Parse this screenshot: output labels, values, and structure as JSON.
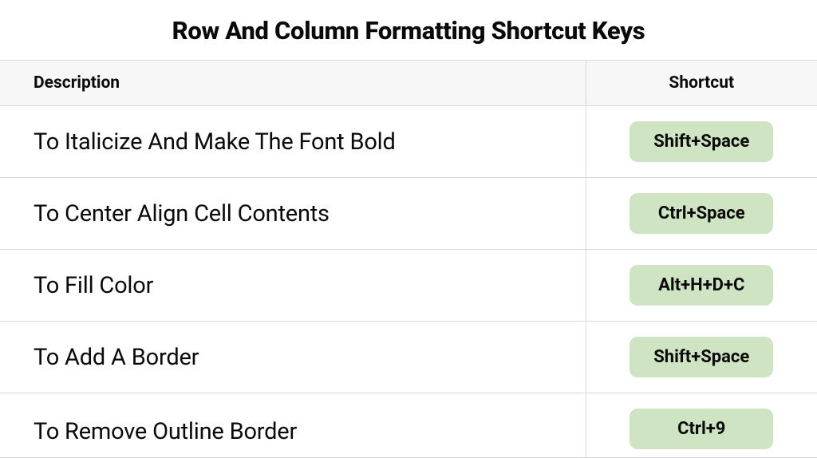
{
  "title": "Row And Column Formatting Shortcut Keys",
  "headers": {
    "description": "Description",
    "shortcut": "Shortcut"
  },
  "rows": [
    {
      "description": "To Italicize And Make The Font Bold",
      "shortcut": "Shift+Space"
    },
    {
      "description": "To Center Align Cell Contents",
      "shortcut": "Ctrl+Space"
    },
    {
      "description": "To Fill Color",
      "shortcut": "Alt+H+D+C"
    },
    {
      "description": "To Add A Border",
      "shortcut": "Shift+Space"
    },
    {
      "description": "To Remove Outline Border",
      "shortcut": "Ctrl+9"
    }
  ],
  "colors": {
    "pill_bg": "#cfe4c2",
    "border": "#d8d8d8",
    "header_bg": "#f7f7f7"
  }
}
